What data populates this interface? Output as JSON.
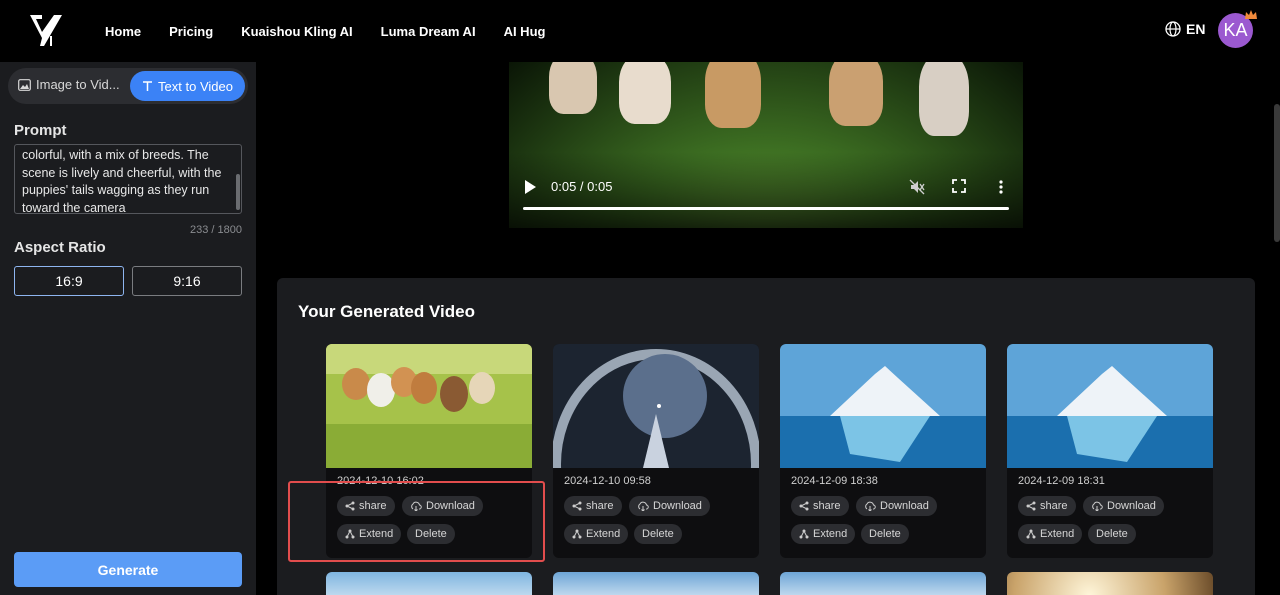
{
  "header": {
    "nav": [
      "Home",
      "Pricing",
      "Kuaishou Kling AI",
      "Luma Dream AI",
      "AI Hug"
    ],
    "language": "EN",
    "avatar_initials": "KA"
  },
  "sidebar": {
    "mode_image": "Image to Vid...",
    "mode_text": "Text to Video",
    "prompt_label": "Prompt",
    "prompt_text": "colorful, with a mix of breeds. The scene is lively and cheerful, with the puppies' tails wagging as they run toward the camera",
    "char_counter": "233 / 1800",
    "aspect_label": "Aspect Ratio",
    "ratio_a": "16:9",
    "ratio_b": "9:16",
    "generate_label": "Generate"
  },
  "player": {
    "time": "0:05 / 0:05",
    "progress": 1.0
  },
  "generated": {
    "title": "Your Generated Video",
    "cards": [
      {
        "date": "2024-12-10 16:02",
        "thumb": "puppies"
      },
      {
        "date": "2024-12-10 09:58",
        "thumb": "space"
      },
      {
        "date": "2024-12-09 18:38",
        "thumb": "iceberg"
      },
      {
        "date": "2024-12-09 18:31",
        "thumb": "iceberg"
      }
    ],
    "actions": {
      "share": "share",
      "download": "Download",
      "extend": "Extend",
      "delete": "Delete"
    }
  },
  "colors": {
    "accent": "#3b82f6",
    "generate": "#5b9cf6",
    "highlight": "#e24d4d"
  }
}
